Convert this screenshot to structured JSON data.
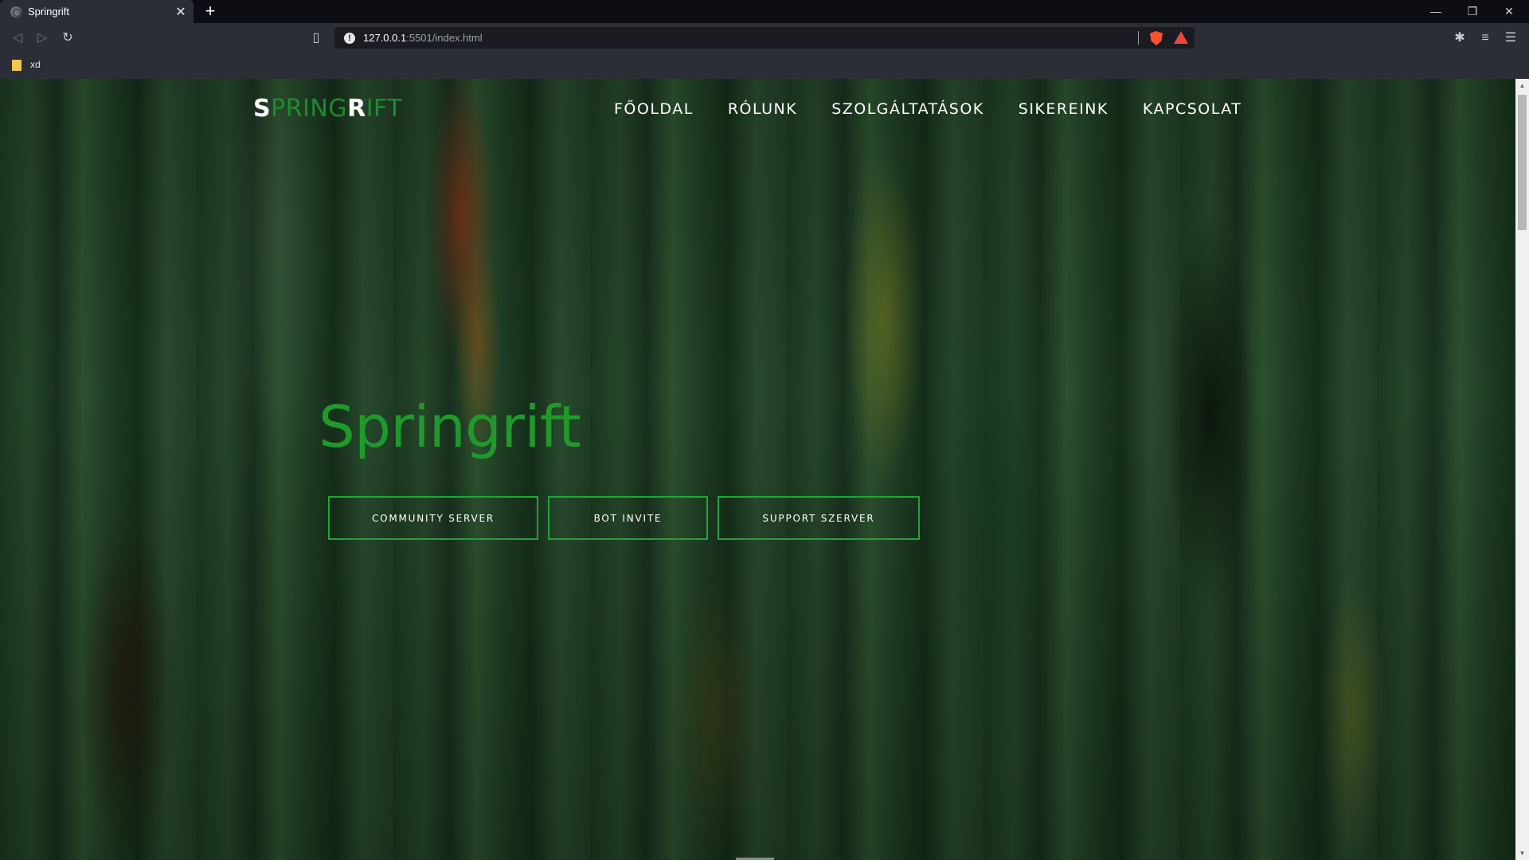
{
  "browser": {
    "tab_title": "Springrift",
    "tab_close": "✕",
    "new_tab": "+",
    "url_host": "127.0.0.1",
    "url_path": ":5501/index.html",
    "bookmark_label": "xd",
    "window_controls": {
      "minimize": "—",
      "restore": "❐",
      "close": "✕"
    }
  },
  "nav": {
    "logo": {
      "s1": "S",
      "rest1": "PRING",
      "s2": "R",
      "rest2": "IFT"
    },
    "links": [
      "FŐOLDAL",
      "RÓLUNK",
      "SZOLGÁLTATÁSOK",
      "SIKEREINK",
      "KAPCSOLAT"
    ]
  },
  "hero": {
    "title": "Springrift",
    "buttons": [
      "COMMUNITY SERVER",
      "BOT INVITE",
      "SUPPORT SZERVER"
    ]
  },
  "colors": {
    "accent_green": "#1f9a2a",
    "button_border": "#21a338",
    "chrome_bg": "#2b2e37"
  }
}
